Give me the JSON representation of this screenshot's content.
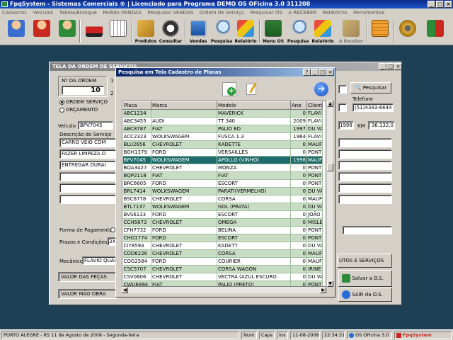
{
  "app": {
    "title": "FpqSystem - Sistemas Comerciais ® | Licenciado para  Programa DEMO OS OFicina 3.0 311208"
  },
  "menu": [
    "Cadastros",
    "Veiculos",
    "Tabela/Estoque",
    "Pedido VENDAS",
    "Pesquisar VENDAS",
    "Ordem de Serviço",
    "Pesquisar OS",
    "A RECEBER",
    "Relatórios",
    "Ferramentas"
  ],
  "toolbar": {
    "produtos": "Produtos",
    "consultar": "Consultar",
    "vendas": "Vendas",
    "pesquisa1": "Pesquisa",
    "relatorio1": "Relatório",
    "menu_os": "Menu OS",
    "pesquisa2": "Pesquisa",
    "relatorio2": "Relatório",
    "a_receber": "A Receber"
  },
  "order_window": {
    "title": "TELA DA ORDEM DE SERVIÇOS",
    "n_ordem_label": "Nº DA ORDEM",
    "n_ordem_value": "10",
    "radio_os": "ORDEM SERVIÇO",
    "radio_orc": "ORÇAMENTO",
    "pesquisar": "Pesquisar",
    "telefone_label": "Telefone",
    "telefone_value": "(51)4343-6644",
    "veiculo_label": "Veículo",
    "veiculo_value": "BPV7045",
    "ano_value": "1998",
    "km_label": "KM",
    "km_value": "36.132,0",
    "descricao_label": "Descrição do Serviço",
    "descricao_lines": [
      "CARRO VEIO COM",
      "FAZER LIMPEZA D",
      "ENTREGAR DURAI"
    ],
    "forma_pag_label": "Forma de Pagamento:",
    "prazos_label": "Prazos e  Condições:",
    "prazos_value": "3X",
    "mecanico_label": "Mecânico",
    "mecanico_value": "FLAVIO QUADR",
    "produtos_servicos": "UTOS E SERVIÇOS",
    "valor_pecas": "VALOR DAS PEÇAS",
    "valor_mao": "VALOR MÃO OBRA",
    "salvar": "Salvar a O.S.",
    "sair": "SAIR da O.S."
  },
  "dialog": {
    "title": "Pesquisa em Tela Cadastro de Placas",
    "columns": [
      "Placa",
      "Marca",
      "Modelo",
      "Ano",
      "Cliente"
    ],
    "rows": [
      [
        "ABC1234",
        "",
        "MAVERICK",
        "0",
        "FLAVI"
      ],
      [
        "ABC3455",
        "AUDI",
        "TT 340",
        "2009",
        "FLAVI"
      ],
      [
        "ABC8787",
        "FIAT",
        "PALIO ED",
        "1997",
        "DU VA"
      ],
      [
        "ACC2323",
        "WOLKSWAGEM",
        "FUSCA 1.3",
        "1964",
        "FLAVI"
      ],
      [
        "BLU2656",
        "CHEVROLET",
        "KADETTE",
        "0",
        "MAUF"
      ],
      [
        "BOH1379",
        "FORD",
        "VERSAILLES",
        "0",
        "PONT"
      ],
      [
        "BPV7045",
        "WOLKSWAGEM",
        "APOLLO (VINHO)",
        "1998",
        "MAUF"
      ],
      [
        "BQA3427",
        "CHEVROLET",
        "MONZA",
        "0",
        "PONT"
      ],
      [
        "BQP2118",
        "FIAT",
        "FIAT",
        "0",
        "PONT"
      ],
      [
        "BRC6605",
        "FORD",
        "ESCORT",
        "0",
        "PONT"
      ],
      [
        "BRL7414",
        "WOLKSWAGEM",
        "PARATI(VERMELHO)",
        "0",
        "DU VA"
      ],
      [
        "BSC6778",
        "CHEVROLET",
        "CORSA",
        "0",
        "MAUF"
      ],
      [
        "BTL7137",
        "WOLKSWAGEM",
        "GOL (PRATA)",
        "0",
        "DU VA"
      ],
      [
        "BVS6133",
        "FORD",
        "ESCORT",
        "0",
        "JOÃO"
      ],
      [
        "CCH5873",
        "CHEVROLET",
        "OMEGA",
        "0",
        "MISLE"
      ],
      [
        "CFH7732",
        "FORD",
        "BELINA",
        "0",
        "PONT"
      ],
      [
        "CHO1774",
        "FORD",
        "ESCORT",
        "0",
        "PONT"
      ],
      [
        "CIY8594",
        "CHEVROLET",
        "KADETT",
        "0",
        "DU VA"
      ],
      [
        "COD6226",
        "CHEVROLET",
        "CORSA",
        "0",
        "MAUF"
      ],
      [
        "COG2584",
        "FORD",
        "COURIER",
        "0",
        "MAUF"
      ],
      [
        "CSC5707",
        "CHEVROLET",
        "CORSA WAGON",
        "0",
        "IRINE"
      ],
      [
        "CSV0606",
        "CHEVROLET",
        "VECTRA (AZUL ESCURO",
        "0",
        "DU VA"
      ],
      [
        "CWU6894",
        "FIAT",
        "PALIO (PRETO)",
        "0",
        "PONT"
      ]
    ],
    "selected_index": 6
  },
  "status": {
    "location": "PORTO ALEGRE - RS 11 de Agosto de 2008 - Segunda-feira",
    "num": "Num",
    "caps": "Caps",
    "ins": "Ins",
    "date": "11-08-2008",
    "time": "22:34:31",
    "program": "OS OFicina 3.0",
    "brand": "FpqSystem"
  },
  "colors": {
    "row_green": "#c9dcc4",
    "row_selected": "#1e6b6b",
    "titlebar": "#0a246a",
    "desktop": "#1d4054"
  }
}
